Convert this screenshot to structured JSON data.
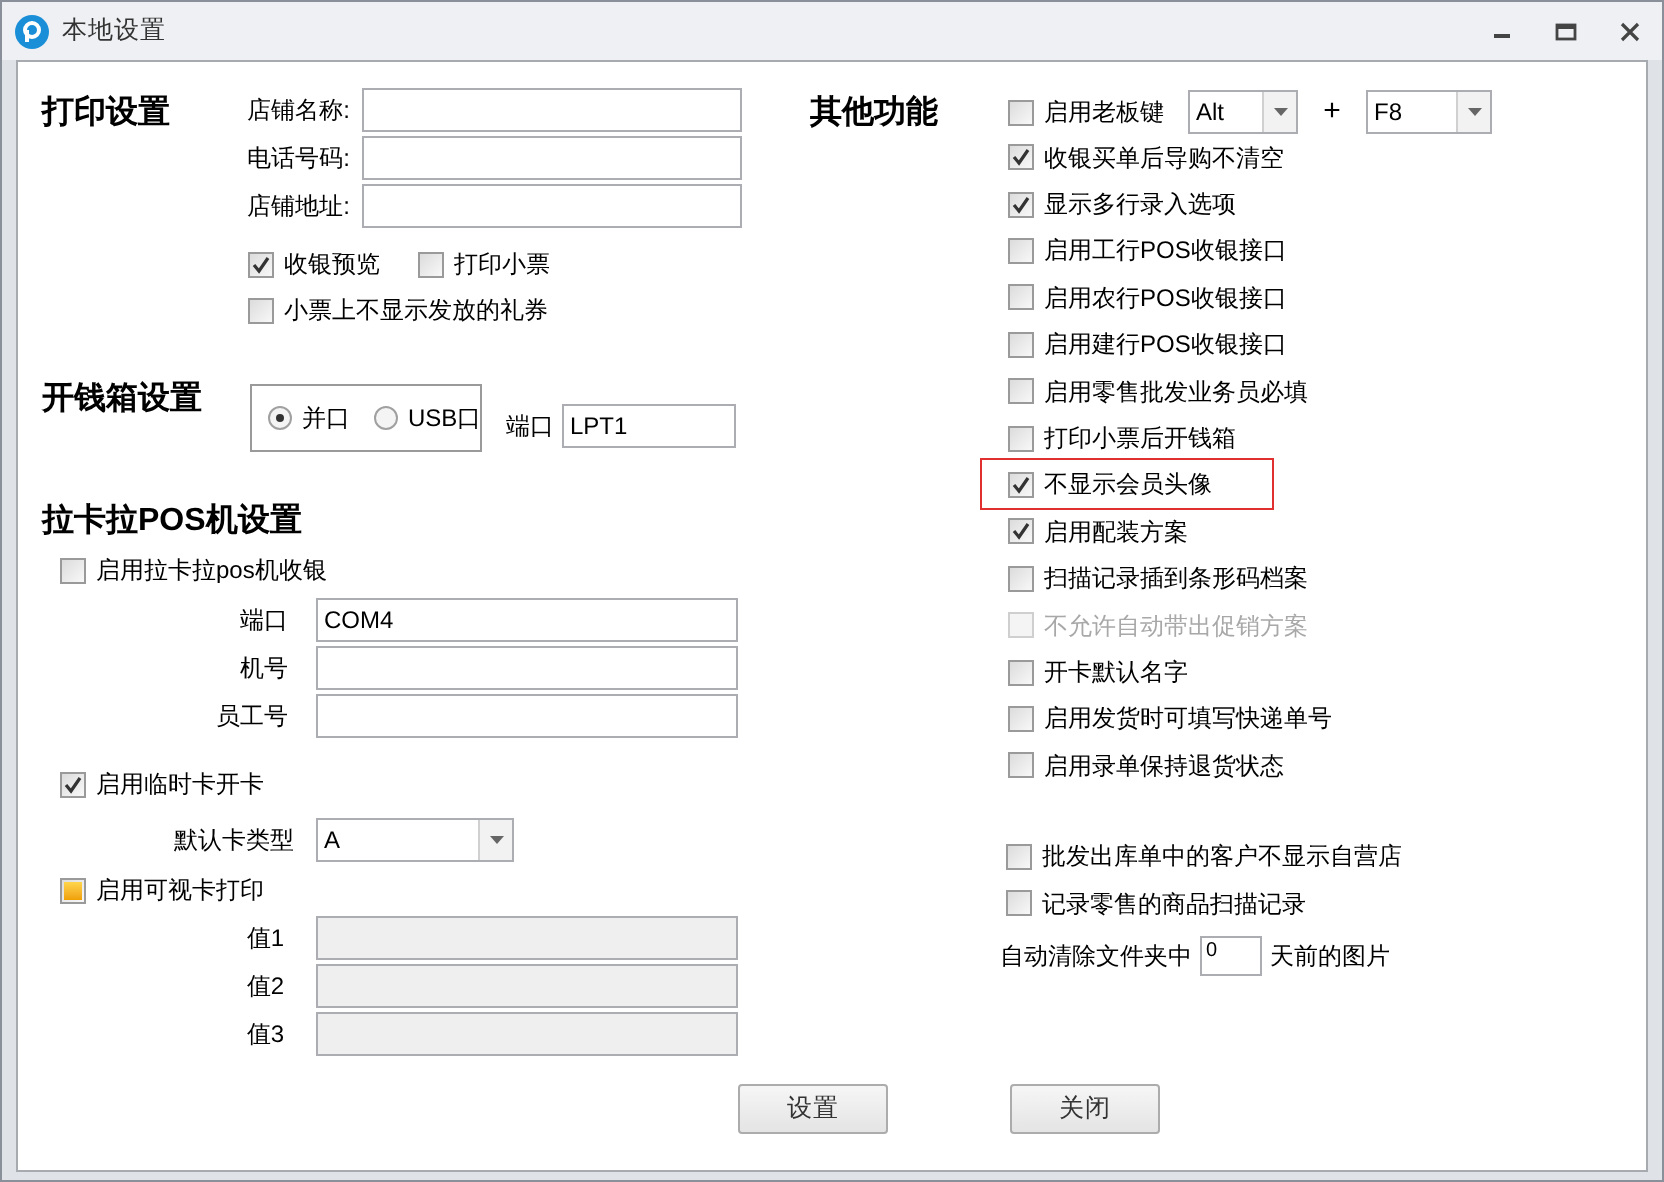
{
  "window": {
    "title": "本地设置"
  },
  "print_settings": {
    "heading": "打印设置",
    "fields": [
      {
        "label": "店铺名称:"
      },
      {
        "label": "电话号码:"
      },
      {
        "label": "店铺地址:"
      }
    ],
    "options": [
      {
        "label": "收银预览",
        "checked": true
      },
      {
        "label": "打印小票",
        "checked": false
      },
      {
        "label": "小票上不显示发放的礼券",
        "checked": false
      }
    ]
  },
  "cash_drawer": {
    "heading": "开钱箱设置",
    "ports": [
      {
        "label": "并口",
        "selected": true
      },
      {
        "label": "USB口",
        "selected": false
      }
    ],
    "port_label": "端口",
    "port_value": "LPT1"
  },
  "lakala": {
    "heading": "拉卡拉POS机设置",
    "enable": {
      "label": "启用拉卡拉pos机收银",
      "checked": false,
      "indeterminate": false
    },
    "fields": [
      {
        "label": "端口",
        "value": "COM4"
      },
      {
        "label": "机号"
      },
      {
        "label": "员工号"
      }
    ],
    "temp_card": {
      "label": "启用临时卡开卡",
      "checked": true,
      "indeterminate": false
    },
    "card_type": {
      "label": "默认卡类型",
      "value": "A"
    },
    "visual_print": {
      "label": "启用可视卡打印",
      "checked": false,
      "indeterminate": true
    },
    "values": [
      {
        "label": "值1",
        "disabled": true
      },
      {
        "label": "值2",
        "disabled": true
      },
      {
        "label": "值3",
        "disabled": true
      }
    ]
  },
  "other": {
    "heading": "其他功能",
    "items": [
      {
        "kind": "hotkey",
        "label": "启用老板键",
        "checked": false,
        "disabled": false,
        "highlighted": false,
        "modifier": "Alt",
        "plus": "+",
        "key": "F8"
      },
      {
        "kind": "checkbox",
        "label": "收银买单后导购不清空",
        "checked": true,
        "disabled": false,
        "highlighted": false
      },
      {
        "kind": "checkbox",
        "label": "显示多行录入选项",
        "checked": true,
        "disabled": false,
        "highlighted": false
      },
      {
        "kind": "checkbox",
        "label": "启用工行POS收银接口",
        "checked": false,
        "disabled": false,
        "highlighted": false
      },
      {
        "kind": "checkbox",
        "label": "启用农行POS收银接口",
        "checked": false,
        "disabled": false,
        "highlighted": false
      },
      {
        "kind": "checkbox",
        "label": "启用建行POS收银接口",
        "checked": false,
        "disabled": false,
        "highlighted": false
      },
      {
        "kind": "checkbox",
        "label": "启用零售批发业务员必填",
        "checked": false,
        "disabled": false,
        "highlighted": false
      },
      {
        "kind": "checkbox",
        "label": "打印小票后开钱箱",
        "checked": false,
        "disabled": false,
        "highlighted": false
      },
      {
        "kind": "checkbox",
        "label": "不显示会员头像",
        "checked": true,
        "disabled": false,
        "highlighted": true
      },
      {
        "kind": "checkbox",
        "label": "启用配装方案",
        "checked": true,
        "disabled": false,
        "highlighted": false
      },
      {
        "kind": "checkbox",
        "label": "扫描记录插到条形码档案",
        "checked": false,
        "disabled": false,
        "highlighted": false
      },
      {
        "kind": "checkbox",
        "label": "不允许自动带出促销方案",
        "checked": false,
        "disabled": true,
        "highlighted": false
      },
      {
        "kind": "checkbox",
        "label": "开卡默认名字",
        "checked": false,
        "disabled": false,
        "highlighted": false
      },
      {
        "kind": "checkbox",
        "label": "启用发货时可填写快递单号",
        "checked": false,
        "disabled": false,
        "highlighted": false
      },
      {
        "kind": "checkbox",
        "label": "启用录单保持退货状态",
        "checked": false,
        "disabled": false,
        "highlighted": false
      }
    ],
    "extra_items": [
      {
        "label": "批发出库单中的客户不显示自营店",
        "checked": false
      },
      {
        "label": "记录零售的商品扫描记录",
        "checked": false
      }
    ],
    "auto_clear": {
      "before": "自动清除文件夹中",
      "value": "0",
      "after": "天前的图片"
    }
  },
  "buttons": [
    {
      "label": "设置"
    },
    {
      "label": "关闭"
    }
  ]
}
